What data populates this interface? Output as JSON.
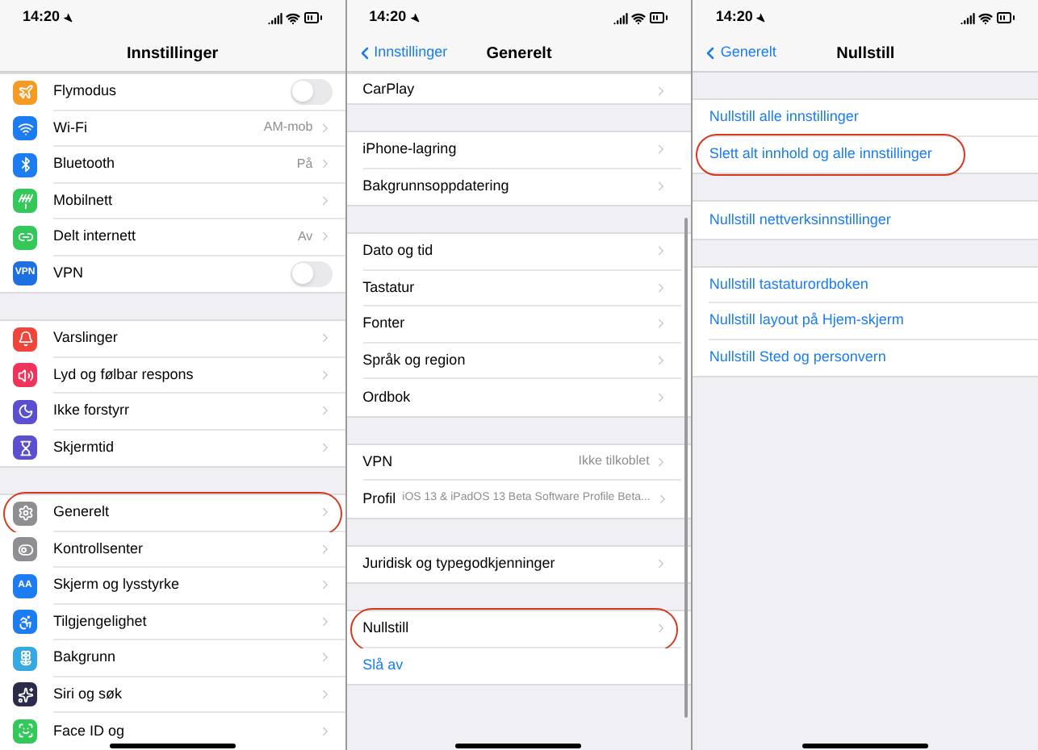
{
  "panels": [
    {
      "time": "14:20",
      "title": "Innstillinger",
      "scrolled": true,
      "sections": [
        {
          "rows": [
            {
              "kind": "toggle",
              "label": "Flymodus",
              "color": "#f59a23",
              "on": false
            },
            {
              "kind": "nav",
              "label": "Wi-Fi",
              "color": "#1e7cf2",
              "value": "AM-mob"
            },
            {
              "kind": "nav",
              "label": "Bluetooth",
              "color": "#1e7cf2",
              "value": "På"
            },
            {
              "kind": "nav",
              "label": "Mobilnett",
              "color": "#34c759"
            },
            {
              "kind": "nav",
              "label": "Delt internett",
              "color": "#34c759",
              "value": "Av"
            },
            {
              "kind": "toggle",
              "label": "VPN",
              "color": "#1e6fe0",
              "icon_text": "VPN",
              "on": false
            }
          ]
        },
        {
          "rows": [
            {
              "kind": "nav",
              "label": "Varslinger",
              "color": "#f0453a"
            },
            {
              "kind": "nav",
              "label": "Lyd og følbar respons",
              "color": "#f0335a"
            },
            {
              "kind": "nav",
              "label": "Ikke forstyrr",
              "color": "#5a4fcf"
            },
            {
              "kind": "nav",
              "label": "Skjermtid",
              "color": "#5a4fcf"
            }
          ]
        },
        {
          "rows": [
            {
              "kind": "nav",
              "label": "Generelt",
              "color": "#8e8e93",
              "highlighted": true
            },
            {
              "kind": "nav",
              "label": "Kontrollsenter",
              "color": "#8e8e93"
            },
            {
              "kind": "nav",
              "label": "Skjerm og lysstyrke",
              "color": "#1e7cf2",
              "icon_text": "AA"
            },
            {
              "kind": "nav",
              "label": "Tilgjengelighet",
              "color": "#1e7cf2"
            },
            {
              "kind": "nav",
              "label": "Bakgrunn",
              "color": "#35a9e0"
            },
            {
              "kind": "nav",
              "label": "Siri og søk",
              "color": "#2b2b4a"
            },
            {
              "kind": "nav",
              "label": "Face ID og",
              "color": "#34c759"
            }
          ]
        }
      ]
    },
    {
      "time": "14:20",
      "back": "Innstillinger",
      "title": "Generelt",
      "scrolled": true,
      "sections": [
        {
          "rows": [
            {
              "kind": "nav",
              "label": "CarPlay",
              "clipped": true
            }
          ]
        },
        {
          "rows": [
            {
              "kind": "nav",
              "label": "iPhone-lagring"
            },
            {
              "kind": "nav",
              "label": "Bakgrunnsoppdatering"
            }
          ]
        },
        {
          "rows": [
            {
              "kind": "nav",
              "label": "Dato og tid"
            },
            {
              "kind": "nav",
              "label": "Tastatur"
            },
            {
              "kind": "nav",
              "label": "Fonter"
            },
            {
              "kind": "nav",
              "label": "Språk og region"
            },
            {
              "kind": "nav",
              "label": "Ordbok"
            }
          ]
        },
        {
          "rows": [
            {
              "kind": "nav",
              "label": "VPN",
              "value": "Ikke tilkoblet"
            },
            {
              "kind": "nav",
              "label": "Profil",
              "value": "iOS 13 & iPadOS 13 Beta Software Profile Beta..."
            }
          ]
        },
        {
          "rows": [
            {
              "kind": "nav",
              "label": "Juridisk og typegodkjenninger"
            }
          ]
        },
        {
          "rows": [
            {
              "kind": "nav",
              "label": "Nullstill",
              "highlighted": true
            },
            {
              "kind": "action",
              "label": "Slå av"
            }
          ]
        }
      ]
    },
    {
      "time": "14:20",
      "back": "Generelt",
      "title": "Nullstill",
      "scrolled": false,
      "sections": [
        {
          "rows": [
            {
              "kind": "action",
              "label": "Nullstill alle innstillinger"
            },
            {
              "kind": "action",
              "label": "Slett alt innhold og alle innstillinger",
              "highlighted": true
            }
          ]
        },
        {
          "rows": [
            {
              "kind": "action",
              "label": "Nullstill nettverksinnstillinger"
            }
          ]
        },
        {
          "rows": [
            {
              "kind": "action",
              "label": "Nullstill tastaturordboken"
            },
            {
              "kind": "action",
              "label": "Nullstill layout på Hjem-skjerm"
            },
            {
              "kind": "action",
              "label": "Nullstill Sted og personvern"
            }
          ]
        }
      ]
    }
  ]
}
